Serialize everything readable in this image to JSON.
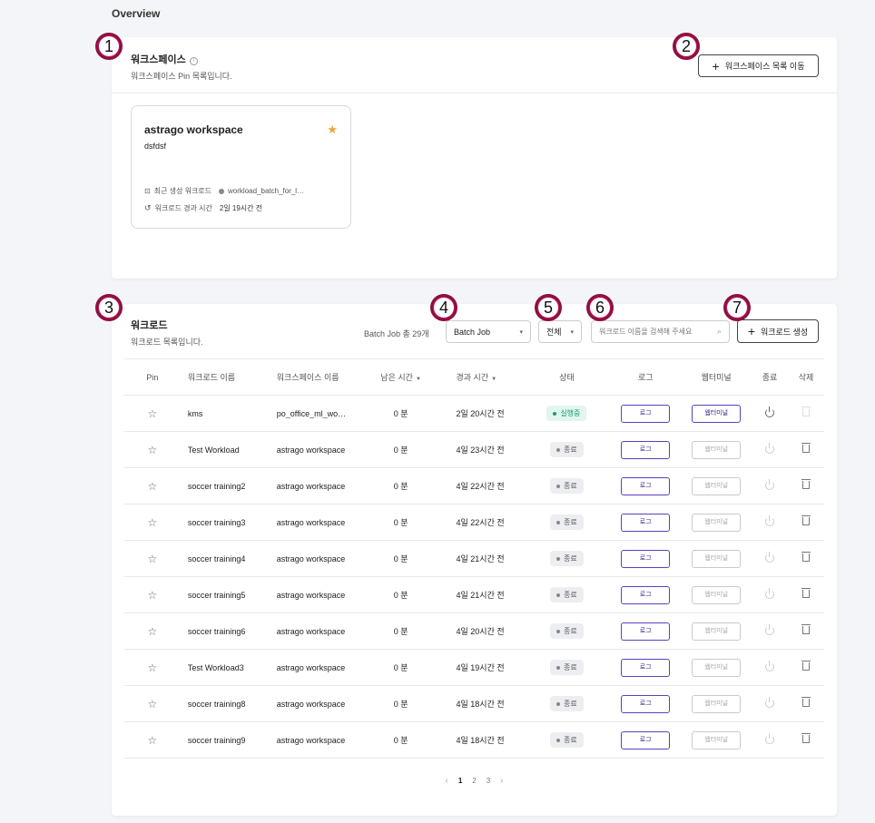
{
  "page": {
    "title": "Overview"
  },
  "workspace_section": {
    "title": "워크스페이스",
    "subtitle": "워크스페이스 Pin 목록입니다.",
    "move_button": "워크스페이스 목록 이동",
    "card": {
      "name": "astrago workspace",
      "description": "dsfdsf",
      "recent_label": "최근 생성 워크로드",
      "recent_value": "workload_batch_for_l…",
      "elapsed_label": "워크로드 경과 시간",
      "elapsed_value": "2일 19시간 전"
    }
  },
  "workload_section": {
    "title": "워크로드",
    "subtitle": "워크로드 목록입니다.",
    "count_text": "Batch Job 총 29개",
    "type_select": "Batch Job",
    "status_select": "전체",
    "search_placeholder": "워크로드 이름을 검색해 주세요",
    "create_button": "워크로드 생성",
    "columns": {
      "pin": "Pin",
      "name": "워크로드 이름",
      "workspace": "워크스페이스 이름",
      "remaining": "남은 시간",
      "elapsed": "경과 시간",
      "status": "상태",
      "log": "로그",
      "terminal": "웹터미널",
      "stop": "종료",
      "delete": "삭제"
    },
    "log_label": "로그",
    "terminal_label": "웹터미널",
    "rows": [
      {
        "name": "kms",
        "workspace": "po_office_ml_wo…",
        "remaining": "0 분",
        "elapsed": "2일 20시간 전",
        "status": "실행중",
        "running": true
      },
      {
        "name": "Test Workload",
        "workspace": "astrago workspace",
        "remaining": "0 분",
        "elapsed": "4일 23시간 전",
        "status": "종료",
        "running": false
      },
      {
        "name": "soccer training2",
        "workspace": "astrago workspace",
        "remaining": "0 분",
        "elapsed": "4일 22시간 전",
        "status": "종료",
        "running": false
      },
      {
        "name": "soccer training3",
        "workspace": "astrago workspace",
        "remaining": "0 분",
        "elapsed": "4일 22시간 전",
        "status": "종료",
        "running": false
      },
      {
        "name": "soccer training4",
        "workspace": "astrago workspace",
        "remaining": "0 분",
        "elapsed": "4일 21시간 전",
        "status": "종료",
        "running": false
      },
      {
        "name": "soccer training5",
        "workspace": "astrago workspace",
        "remaining": "0 분",
        "elapsed": "4일 21시간 전",
        "status": "종료",
        "running": false
      },
      {
        "name": "soccer training6",
        "workspace": "astrago workspace",
        "remaining": "0 분",
        "elapsed": "4일 20시간 전",
        "status": "종료",
        "running": false
      },
      {
        "name": "Test Workload3",
        "workspace": "astrago workspace",
        "remaining": "0 분",
        "elapsed": "4일 19시간 전",
        "status": "종료",
        "running": false
      },
      {
        "name": "soccer training8",
        "workspace": "astrago workspace",
        "remaining": "0 분",
        "elapsed": "4일 18시간 전",
        "status": "종료",
        "running": false
      },
      {
        "name": "soccer training9",
        "workspace": "astrago workspace",
        "remaining": "0 분",
        "elapsed": "4일 18시간 전",
        "status": "종료",
        "running": false
      }
    ],
    "pagination": {
      "pages": [
        "1",
        "2",
        "3"
      ],
      "current": "1"
    }
  },
  "markers": [
    "1",
    "2",
    "3",
    "4",
    "5",
    "6",
    "7"
  ],
  "colors": {
    "accent": "#5b3fbf",
    "running": "#1c9a6b",
    "star": "#f0a33b",
    "marker": "#c2185b"
  },
  "icons": {
    "pin": "star-outline-icon",
    "pinned": "star-filled-icon",
    "stop": "power-icon",
    "delete": "trash-icon",
    "search": "search-icon"
  }
}
